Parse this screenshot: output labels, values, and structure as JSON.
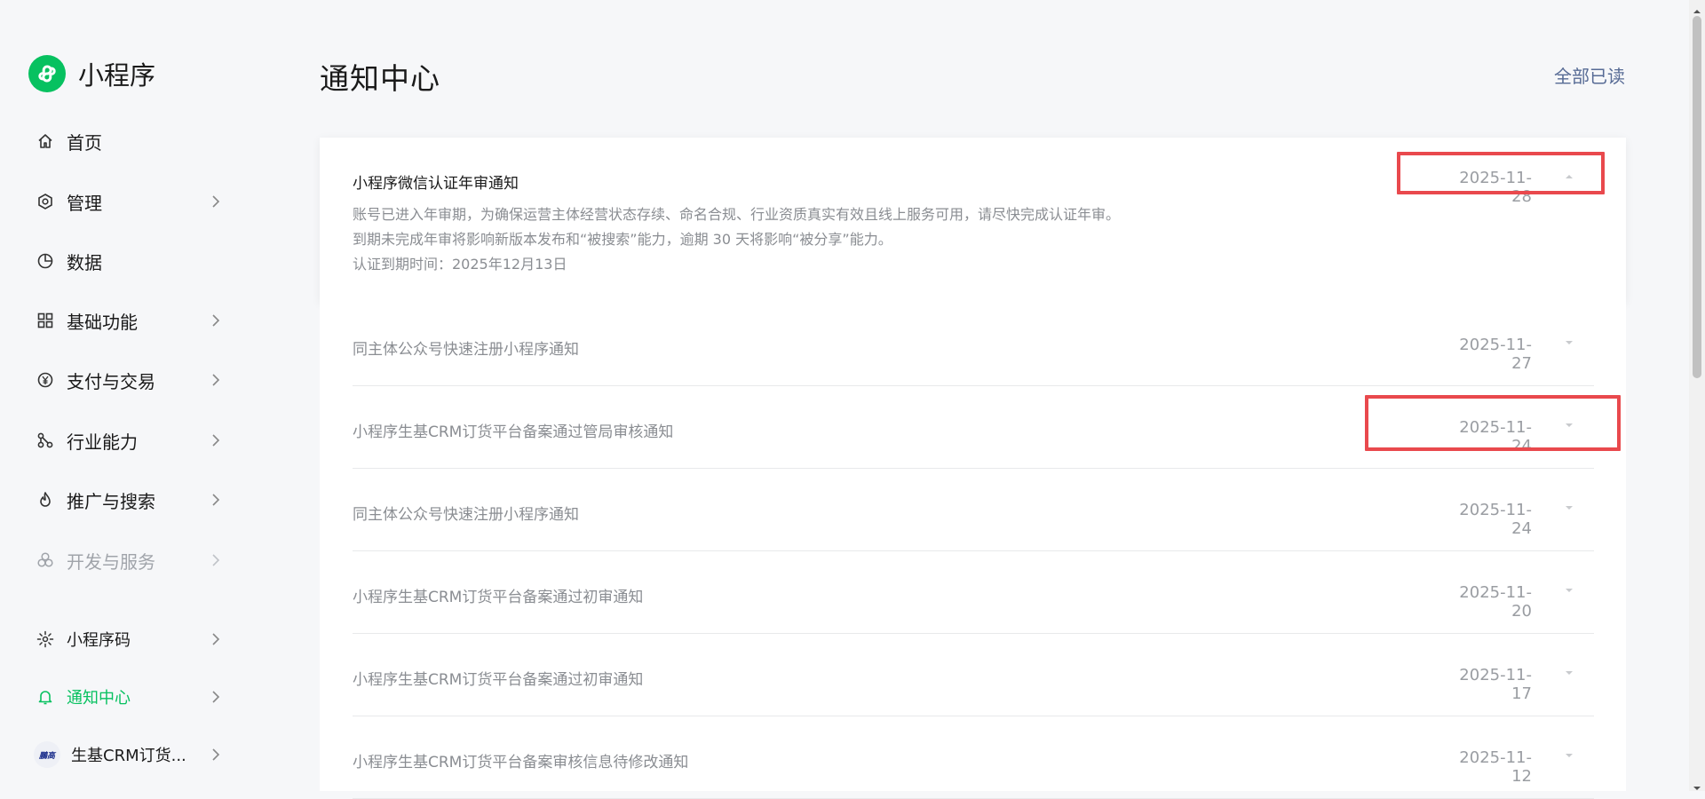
{
  "app": {
    "title": "小程序"
  },
  "colors": {
    "brand": "#07c160",
    "link": "#576b95",
    "highlight": "#e9494d"
  },
  "sidebar": {
    "items": [
      {
        "label": "首页",
        "icon": "home-icon",
        "has_arrow": false
      },
      {
        "label": "管理",
        "icon": "hexagon-settings-icon",
        "has_arrow": true
      },
      {
        "label": "数据",
        "icon": "pie-chart-icon",
        "has_arrow": false
      },
      {
        "label": "基础功能",
        "icon": "grid-apps-icon",
        "has_arrow": true
      },
      {
        "label": "支付与交易",
        "icon": "yuan-coin-icon",
        "has_arrow": true
      },
      {
        "label": "行业能力",
        "icon": "molecule-icon",
        "has_arrow": true
      },
      {
        "label": "推广与搜索",
        "icon": "flame-icon",
        "has_arrow": true
      },
      {
        "label": "开发与服务",
        "icon": "circles-icon",
        "has_arrow": true,
        "state": "disabled"
      }
    ],
    "bottom": [
      {
        "label": "小程序码",
        "icon": "sun-icon",
        "has_arrow": true
      },
      {
        "label": "通知中心",
        "icon": "bell-icon",
        "has_arrow": true,
        "state": "active"
      },
      {
        "label": "生基CRM订货...",
        "icon": "account-avatar",
        "avatar_text": "鵬高",
        "has_arrow": true
      }
    ]
  },
  "main": {
    "title": "通知中心",
    "mark_all_read": "全部已读",
    "expanded": {
      "title": "小程序微信认证年审通知",
      "date": "2025-11-28",
      "lines": [
        "账号已进入年审期，为确保运营主体经营状态存续、命名合规、行业资质真实有效且线上服务可用，请尽快完成认证年审。",
        "到期未完成年审将影响新版本发布和“被搜索”能力，逾期 30 天将影响“被分享”能力。",
        "认证到期时间：2025年12月13日"
      ]
    },
    "notifications": [
      {
        "title": "同主体公众号快速注册小程序通知",
        "date": "2025-11-27"
      },
      {
        "title": "小程序生基CRM订货平台备案通过管局审核通知",
        "date": "2025-11-24"
      },
      {
        "title": "同主体公众号快速注册小程序通知",
        "date": "2025-11-24"
      },
      {
        "title": "小程序生基CRM订货平台备案通过初审通知",
        "date": "2025-11-20"
      },
      {
        "title": "小程序生基CRM订货平台备案通过初审通知",
        "date": "2025-11-17"
      },
      {
        "title": "小程序生基CRM订货平台备案审核信息待修改通知",
        "date": "2025-11-12"
      }
    ]
  }
}
